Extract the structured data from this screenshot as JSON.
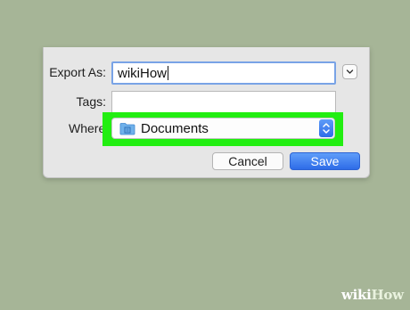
{
  "dialog": {
    "export_as": {
      "label": "Export As:",
      "value": "wikiHow"
    },
    "tags": {
      "label": "Tags:",
      "value": ""
    },
    "where": {
      "label": "Where",
      "value": "Documents",
      "icon": "folder-icon"
    },
    "expand_icon": "chevron-down-icon",
    "buttons": {
      "cancel": "Cancel",
      "save": "Save"
    }
  },
  "colors": {
    "highlight": "#22ee11",
    "accent": "#2f6ce8"
  },
  "watermark": {
    "wiki": "wiki",
    "how": "How"
  }
}
